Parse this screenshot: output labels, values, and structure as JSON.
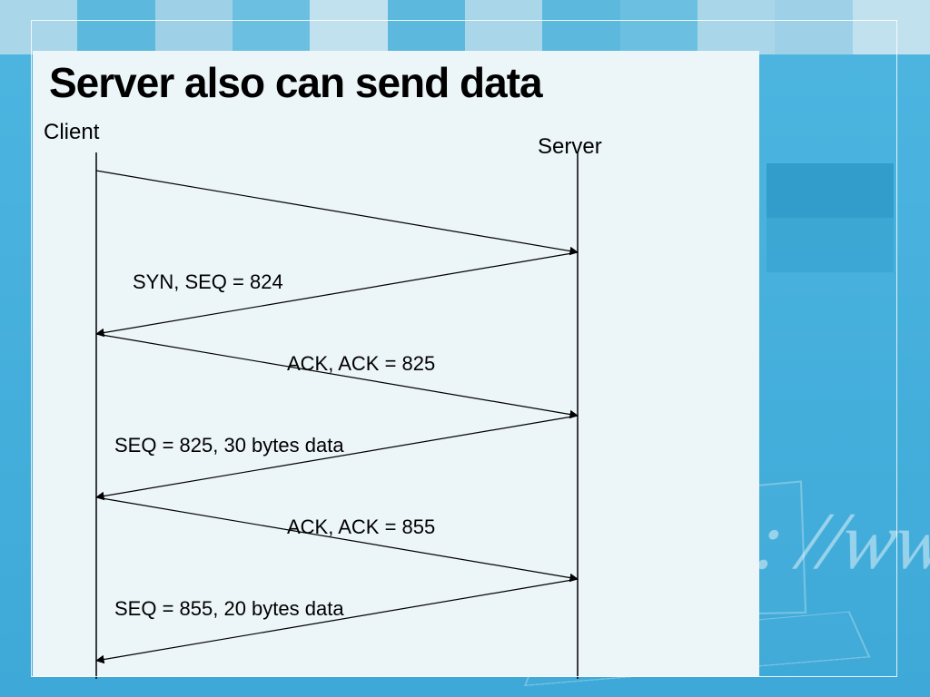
{
  "title": "Server also can send data",
  "endpoints": {
    "client": "Client",
    "server": "Server"
  },
  "messages": [
    {
      "id": "m1",
      "direction": "c2s",
      "label": "SYN, SEQ = 824"
    },
    {
      "id": "m2",
      "direction": "s2c",
      "label": "ACK, ACK = 825"
    },
    {
      "id": "m3",
      "direction": "c2s",
      "label": "SEQ = 825, 30 bytes data"
    },
    {
      "id": "m4",
      "direction": "s2c",
      "label": "ACK, ACK = 855"
    },
    {
      "id": "m5",
      "direction": "c2s",
      "label": "SEQ = 855, 20 bytes data"
    },
    {
      "id": "m6",
      "direction": "s2c",
      "label": ""
    }
  ],
  "watermark": "http: //ww",
  "colors": {
    "bg_gradient_top": "#4db5e0",
    "bg_gradient_bottom": "#3ea9d8",
    "panel": "#ecf5f8",
    "title": "#000000",
    "line": "#000000"
  }
}
